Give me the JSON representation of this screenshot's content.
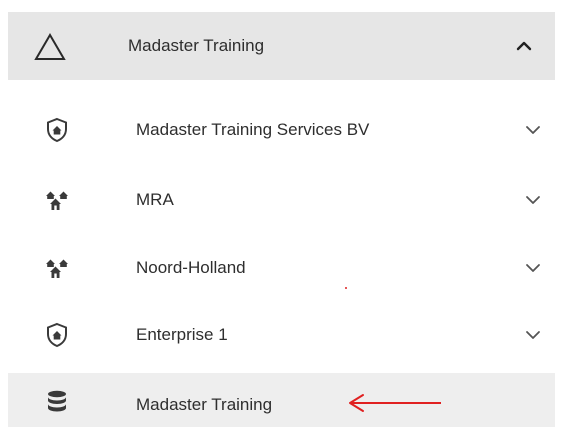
{
  "header": {
    "title": "Madaster Training",
    "icon": "triangle-outline-icon",
    "toggle_icon": "chevron-up-icon"
  },
  "items": [
    {
      "label": "Madaster Training Services BV",
      "icon": "shield-home-icon",
      "toggle_icon": "chevron-down-icon"
    },
    {
      "label": "MRA",
      "icon": "houses-icon",
      "toggle_icon": "chevron-down-icon"
    },
    {
      "label": "Noord-Holland",
      "icon": "houses-icon",
      "toggle_icon": "chevron-down-icon"
    },
    {
      "label": "Enterprise 1",
      "icon": "shield-home-icon",
      "toggle_icon": "chevron-down-icon"
    }
  ],
  "selected": {
    "label": "Madaster Training",
    "icon": "database-icon"
  },
  "annotation": {
    "arrow_color": "#e02020"
  },
  "colors": {
    "header_bg": "#e6e6e6",
    "selected_bg": "#eeeeee",
    "text": "#2e2e2e",
    "icon": "#3a3a3a"
  }
}
